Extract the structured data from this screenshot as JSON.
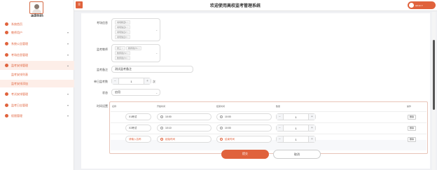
{
  "app": {
    "title": "欢迎使用高校监考管理系统",
    "user_label": "admin ▾"
  },
  "sidebar": {
    "username": "admin",
    "items": [
      {
        "label": "系统首页",
        "has_arrow": false
      },
      {
        "label": "教师用户",
        "has_arrow": true
      },
      {
        "label": "系统公告管理",
        "has_arrow": true
      },
      {
        "label": "考场信息管理",
        "has_arrow": true
      },
      {
        "label": "监考安排管理",
        "has_arrow": true,
        "expanded": true
      },
      {
        "label": "考试安排管理",
        "has_arrow": true
      },
      {
        "label": "监考日志管理",
        "has_arrow": true
      },
      {
        "label": "权限管理",
        "has_arrow": true
      }
    ],
    "submenu": [
      {
        "label": "监考安排列表"
      },
      {
        "label": "监考安排添加"
      }
    ]
  },
  "form": {
    "exam_room_label": "考场信息",
    "exam_room_tags": [
      "考场教室1",
      "考场信息1",
      "考场信息2",
      "考场信息3"
    ],
    "teacher_label": "监考教师",
    "teacher_tags": [
      "张三",
      "教师用户1",
      "教师用户2",
      "教师用户3"
    ],
    "note_label": "监考备注",
    "note_value": "测试监考备注",
    "count_label": "单日监考数",
    "count_value": "1",
    "count_unit": "次",
    "status_label": "状态",
    "status_value": "启用",
    "time_label": "时间设置"
  },
  "table": {
    "headers": [
      "名称",
      "开始时间",
      "结束时间",
      "数量",
      "操作"
    ],
    "rows": [
      {
        "name": "X1考试",
        "start": "10:00",
        "end": "10:00",
        "qty": "1",
        "action": "删除",
        "placeholder": false
      },
      {
        "name": "X2考试",
        "start": "10:10",
        "end": "10:00",
        "qty": "1",
        "action": "删除",
        "placeholder": false
      },
      {
        "name": "请输入名称",
        "start": "起始时间",
        "end": "结束时间",
        "qty": "1",
        "action": "删除",
        "placeholder": true
      }
    ]
  },
  "actions": {
    "submit": "提交",
    "cancel": "取消"
  },
  "icons": {
    "menu_toggle": "menu-icon",
    "sidebar": [
      "home-icon",
      "user-icon",
      "notice-icon",
      "room-icon",
      "schedule-icon",
      "exam-icon",
      "log-icon",
      "permission-icon"
    ],
    "clock": "clock-icon",
    "close": "close-icon",
    "chevron": "chevron-down-icon"
  },
  "colors": {
    "accent": "#e0623c",
    "accent_light": "#fdeee8",
    "border": "#dcdcdc"
  }
}
